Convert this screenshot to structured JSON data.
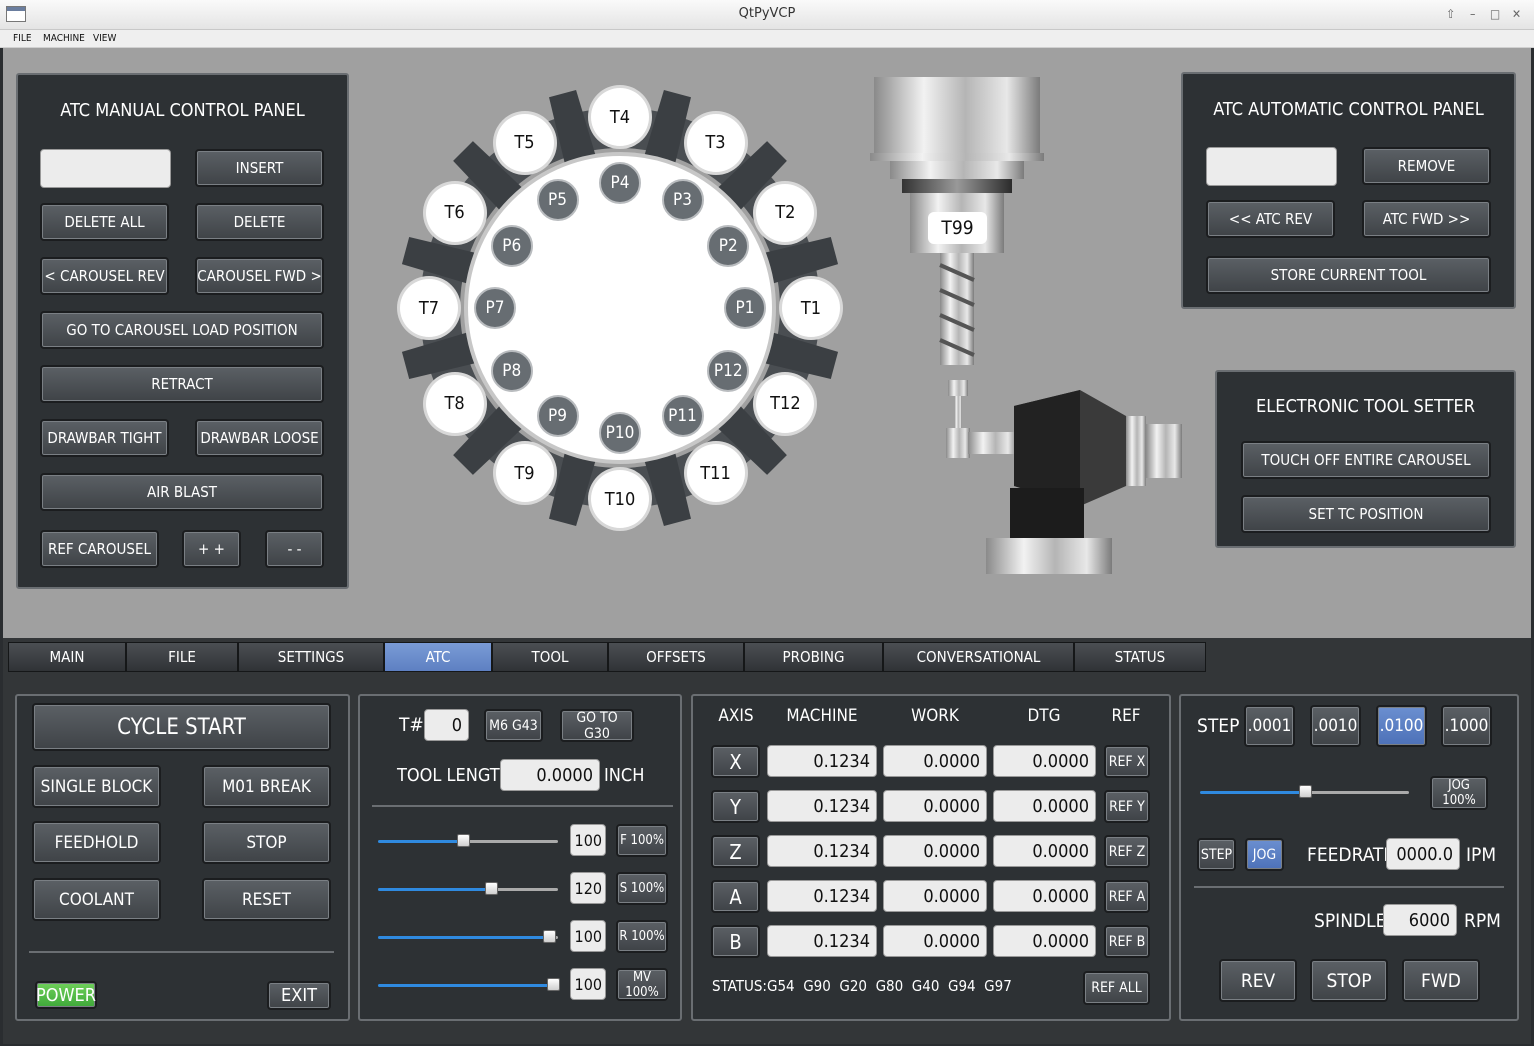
{
  "window": {
    "title": "QtPyVCP",
    "controls": [
      "⇧",
      "–",
      "□",
      "✕"
    ]
  },
  "menu": [
    "FILE",
    "MACHINE",
    "VIEW"
  ],
  "atc_manual": {
    "title": "ATC MANUAL CONTROL PANEL",
    "input_value": "",
    "insert": "INSERT",
    "delete_all": "DELETE ALL",
    "delete": "DELETE",
    "carousel_rev": "< CAROUSEL REV",
    "carousel_fwd": "CAROUSEL FWD >",
    "goto_load": "GO TO CAROUSEL LOAD POSITION",
    "retract": "RETRACT",
    "drawbar_tight": "DRAWBAR TIGHT",
    "drawbar_loose": "DRAWBAR LOOSE",
    "air_blast": "AIR BLAST",
    "ref_carousel": "REF CAROUSEL",
    "plus": "+ +",
    "minus": "- -"
  },
  "carousel": {
    "tools": [
      "T1",
      "T2",
      "T3",
      "T4",
      "T5",
      "T6",
      "T7",
      "T8",
      "T9",
      "T10",
      "T11",
      "T12"
    ],
    "pockets": [
      "P1",
      "P2",
      "P3",
      "P4",
      "P5",
      "P6",
      "P7",
      "P8",
      "P9",
      "P10",
      "P11",
      "P12"
    ]
  },
  "spindle_tool": "T99",
  "atc_auto": {
    "title": "ATC AUTOMATIC CONTROL PANEL",
    "input_value": "",
    "remove": "REMOVE",
    "atc_rev": "<< ATC REV",
    "atc_fwd": "ATC FWD >>",
    "store": "STORE CURRENT TOOL"
  },
  "tool_setter": {
    "title": "ELECTRONIC TOOL SETTER",
    "touch_off": "TOUCH OFF ENTIRE CAROUSEL",
    "set_tc": "SET TC POSITION"
  },
  "tabs": [
    "MAIN",
    "FILE",
    "SETTINGS",
    "ATC",
    "TOOL",
    "OFFSETS",
    "PROBING",
    "CONVERSATIONAL",
    "STATUS"
  ],
  "active_tab": "ATC",
  "cycle": {
    "cycle_start": "CYCLE START",
    "single_block": "SINGLE BLOCK",
    "m01_break": "M01 BREAK",
    "feedhold": "FEEDHOLD",
    "stop": "STOP",
    "coolant": "COOLANT",
    "reset": "RESET",
    "power": "POWER",
    "exit": "EXIT"
  },
  "tool": {
    "t_label": "T#",
    "t_value": "0",
    "m6g43": "M6 G43",
    "goto_g30": "GO TO G30",
    "length_label": "TOOL LENGTH",
    "length_value": "0.0000",
    "length_unit": "INCH",
    "overrides": [
      {
        "value": "100",
        "button": "F 100%",
        "level": 0.47
      },
      {
        "value": "120",
        "button": "S 100%",
        "level": 0.63
      },
      {
        "value": "100",
        "button": "R 100%",
        "level": 0.95
      },
      {
        "value": "100",
        "button": "MV 100%",
        "level": 0.97
      }
    ]
  },
  "dro": {
    "headers": [
      "AXIS",
      "MACHINE",
      "WORK",
      "DTG",
      "REF"
    ],
    "rows": [
      {
        "axis": "X",
        "machine": "0.1234",
        "work": "0.0000",
        "dtg": "0.0000",
        "ref": "REF X"
      },
      {
        "axis": "Y",
        "machine": "0.1234",
        "work": "0.0000",
        "dtg": "0.0000",
        "ref": "REF Y"
      },
      {
        "axis": "Z",
        "machine": "0.1234",
        "work": "0.0000",
        "dtg": "0.0000",
        "ref": "REF Z"
      },
      {
        "axis": "A",
        "machine": "0.1234",
        "work": "0.0000",
        "dtg": "0.0000",
        "ref": "REF A"
      },
      {
        "axis": "B",
        "machine": "0.1234",
        "work": "0.0000",
        "dtg": "0.0000",
        "ref": "REF B"
      }
    ],
    "status_label": "STATUS:",
    "status_codes": "G54  G90  G20  G80  G40  G94  G97",
    "ref_all": "REF ALL"
  },
  "jog": {
    "step_label": "STEP",
    "steps": [
      ".0001",
      ".0010",
      ".0100",
      ".1000"
    ],
    "active_step": ".0100",
    "jog_level": 0.5,
    "jog_pct": "JOG 100%",
    "step_btn": "STEP",
    "jog_btn": "JOG",
    "feedrate_label": "FEEDRATE",
    "feedrate_value": "0000.0",
    "feedrate_unit": "IPM",
    "spindle_label": "SPINDLE",
    "spindle_value": "6000",
    "spindle_unit": "RPM",
    "rev": "REV",
    "stop": "STOP",
    "fwd": "FWD"
  },
  "colors": {
    "accent": "#5e80c2",
    "slider": "#2f8ae0",
    "power": "#4fbf3f",
    "panel": "#2d3134",
    "background": "#a0a0a0"
  }
}
